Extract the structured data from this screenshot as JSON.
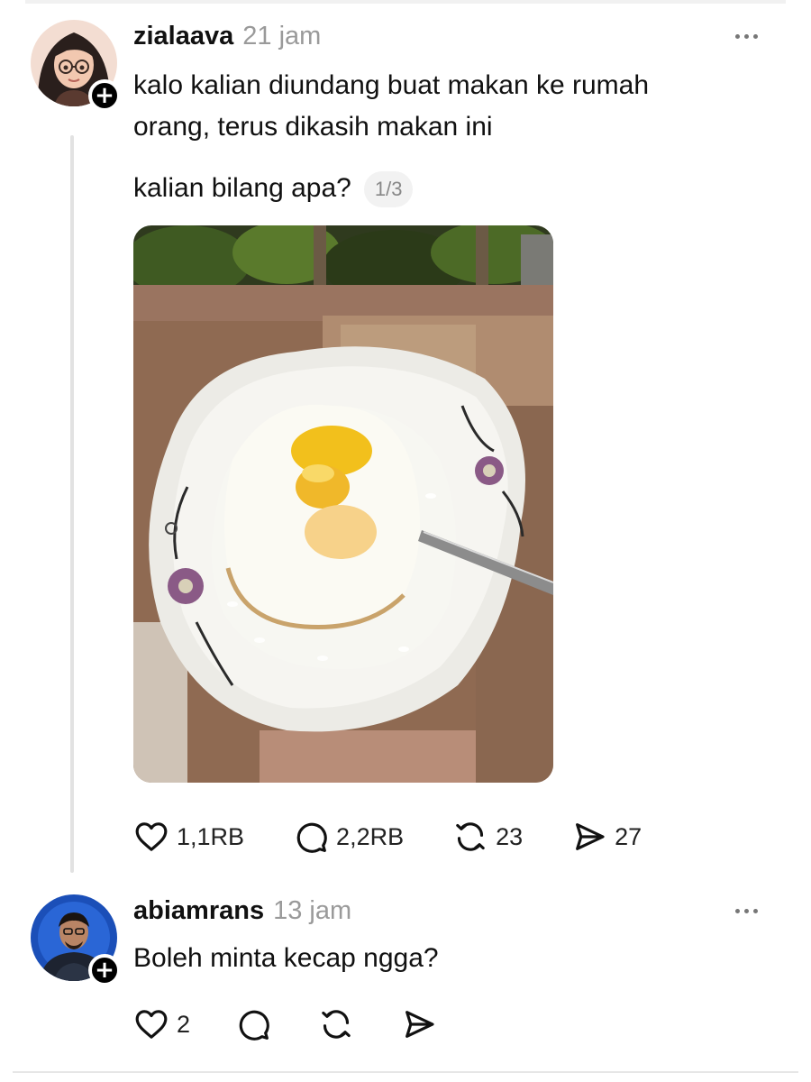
{
  "post": {
    "username": "zialaava",
    "time": "21 jam",
    "text_line1": "kalo kalian diundang buat makan ke rumah",
    "text_line2": "orang, terus dikasih makan ini",
    "text_line3": "kalian bilang apa?",
    "pager": "1/3",
    "likes": "1,1RB",
    "replies": "2,2RB",
    "reposts": "23",
    "shares": "27"
  },
  "reply": {
    "username": "abiamrans",
    "time": "13 jam",
    "text": "Boleh minta kecap ngga?",
    "likes": "2"
  },
  "icons": {
    "follow": "+",
    "more": "more-horizontal-icon",
    "like": "heart-icon",
    "comment": "comment-bubble-icon",
    "repost": "repost-arrows-icon",
    "share": "send-paper-plane-icon"
  },
  "colors": {
    "username": "#111111",
    "timestamp": "#9a9a9a",
    "thread_line": "#e2e2e2"
  }
}
